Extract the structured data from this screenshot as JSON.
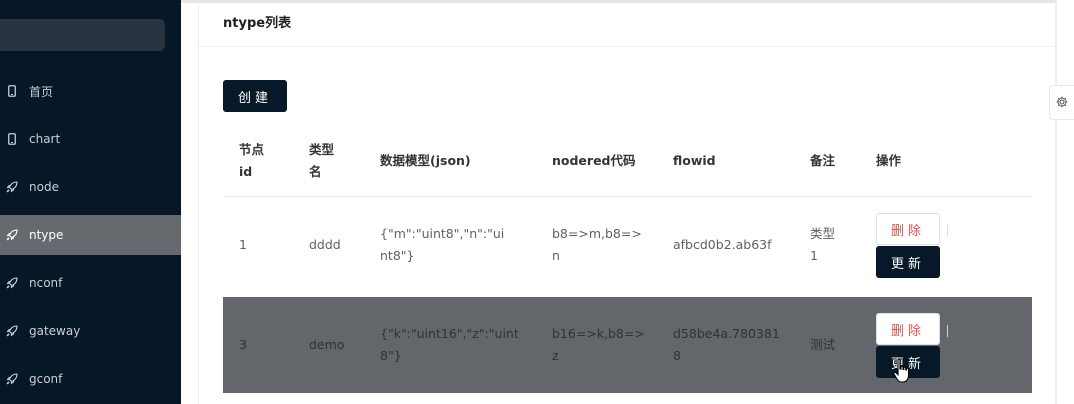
{
  "sidebar": {
    "items": [
      {
        "label": "首页",
        "icon": "mobile-icon",
        "active": false
      },
      {
        "label": "chart",
        "icon": "mobile-icon",
        "active": false
      },
      {
        "label": "node",
        "icon": "rocket-icon",
        "active": false
      },
      {
        "label": "ntype",
        "icon": "rocket-icon",
        "active": true
      },
      {
        "label": "nconf",
        "icon": "rocket-icon",
        "active": false
      },
      {
        "label": "gateway",
        "icon": "rocket-icon",
        "active": false
      },
      {
        "label": "gconf",
        "icon": "rocket-icon",
        "active": false
      }
    ]
  },
  "page": {
    "title": "ntype列表",
    "create_label": "创建"
  },
  "table": {
    "headers": [
      "节点id",
      "类型名",
      "数据模型(json)",
      "nodered代码",
      "flowid",
      "备注",
      "操作"
    ],
    "rows": [
      {
        "id": "1",
        "type_name": "dddd",
        "model": "{\"m\":\"uint8\",\"n\":\"uint8\"}",
        "nodered": "b8=>m,b8=>n",
        "flowid": "afbcd0b2.ab63f",
        "remark": "类型1",
        "delete_label": "删除",
        "update_label": "更新",
        "hover": false
      },
      {
        "id": "3",
        "type_name": "demo",
        "model": "{\"k\":\"uint16\",\"z\":\"uint8\"}",
        "nodered": "b16=>k,b8=>z",
        "flowid": "d58be4a.7803818",
        "remark": "测试",
        "delete_label": "删除",
        "update_label": "更新",
        "hover": true
      }
    ]
  },
  "settings": {
    "icon": "gear-icon"
  },
  "colors": {
    "sidebar_bg": "#061727",
    "active_item_bg": "#666a6e",
    "primary_button": "#071828",
    "danger_text": "#d9534f",
    "hover_row_bg": "#63676b"
  }
}
